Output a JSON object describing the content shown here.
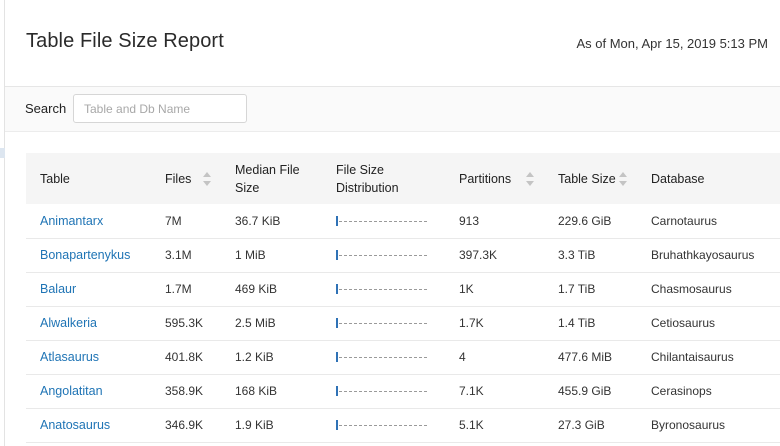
{
  "header": {
    "title": "Table File Size Report",
    "as_of": "As of Mon, Apr 15, 2019 5:13 PM"
  },
  "search": {
    "label": "Search",
    "placeholder": "Table and Db Name",
    "value": ""
  },
  "table": {
    "columns": [
      {
        "label": "Table",
        "sortable": false
      },
      {
        "label": "Files",
        "sortable": true
      },
      {
        "label": "Median File Size",
        "sortable": false
      },
      {
        "label": "File Size Distribution",
        "sortable": false
      },
      {
        "label": "Partitions",
        "sortable": true
      },
      {
        "label": "Table Size",
        "sortable": true
      },
      {
        "label": "Database",
        "sortable": false
      }
    ],
    "rows": [
      {
        "table": "Animantarx",
        "files": "7M",
        "median": "36.7 KiB",
        "partitions": "913",
        "size": "229.6 GiB",
        "database": "Carnotaurus"
      },
      {
        "table": "Bonapartenykus",
        "files": "3.1M",
        "median": "1 MiB",
        "partitions": "397.3K",
        "size": "3.3 TiB",
        "database": "Bruhathkayosaurus"
      },
      {
        "table": "Balaur",
        "files": "1.7M",
        "median": "469 KiB",
        "partitions": "1K",
        "size": "1.7 TiB",
        "database": "Chasmosaurus"
      },
      {
        "table": "Alwalkeria",
        "files": "595.3K",
        "median": "2.5 MiB",
        "partitions": "1.7K",
        "size": "1.4 TiB",
        "database": "Cetiosaurus"
      },
      {
        "table": "Atlasaurus",
        "files": "401.8K",
        "median": "1.2 KiB",
        "partitions": "4",
        "size": "477.6 MiB",
        "database": "Chilantaisaurus"
      },
      {
        "table": "Angolatitan",
        "files": "358.9K",
        "median": "168 KiB",
        "partitions": "7.1K",
        "size": "455.9 GiB",
        "database": "Cerasinops"
      },
      {
        "table": "Anatosaurus",
        "files": "346.9K",
        "median": "1.9 KiB",
        "partitions": "5.1K",
        "size": "27.3 GiB",
        "database": "Byronosaurus"
      }
    ]
  },
  "colors": {
    "link": "#1f74b5",
    "distribution_bar": "#2f72b6"
  }
}
